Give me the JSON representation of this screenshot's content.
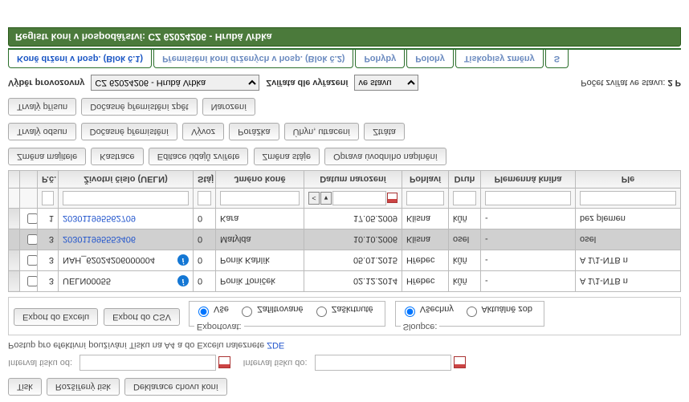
{
  "toolbar_top": {
    "print": "Tisk",
    "ext_print": "Rozšířený tisk",
    "decl": "Deklarace chovu koní"
  },
  "interval": {
    "from_label": "Interval tisku od:",
    "to_label": "Interval tisku do:",
    "from_value": "",
    "to_value": ""
  },
  "help_line": {
    "prefix": "Postup pro efektivní používání Tisku na A4 a do Excelu naleznete ",
    "link": "ZDE"
  },
  "export_row": {
    "excel": "Export do Excelu",
    "csv": "Export do CSV",
    "export_group_label": "Exportovat:",
    "opt_all": "Vše",
    "opt_filtered": "Zafiltrované",
    "opt_checked": "Zaškrtnuté",
    "cols_group_label": "Sloupce:",
    "opt_cols_all": "Všechny",
    "opt_cols_cur": "Aktuálně zob"
  },
  "grid": {
    "headers": {
      "pc": "P.č.",
      "ueln": "Životní číslo (UELN)",
      "staj": "Stáj",
      "jmeno": "Jméno koně",
      "datum": "Datum narození",
      "pohlavi": "Pohlaví",
      "druh": "Druh",
      "kniha": "Plemenná kniha",
      "ple": "Ple"
    },
    "rows": [
      {
        "pc": "3",
        "ueln": "UELN00055",
        "info": true,
        "staj": "0",
        "jmeno": "Poník Toníček",
        "datum": "02.12.2014",
        "pohlavi": "Hřebec",
        "druh": "kůň",
        "kniha": "-",
        "ple": "A 1/1-NTB n",
        "link": false,
        "sel": false
      },
      {
        "pc": "3",
        "ueln": "NAH_62024206000004",
        "info": true,
        "staj": "0",
        "jmeno": "Poník Kahlík",
        "datum": "05.01.2015",
        "pohlavi": "Hřebec",
        "druh": "kůň",
        "kniha": "-",
        "ple": "A 1/1-NTB n",
        "link": false,
        "sel": false
      },
      {
        "pc": "3",
        "ueln": "203011995553406",
        "info": false,
        "staj": "0",
        "jmeno": "Matylda",
        "datum": "10.10.2006",
        "pohlavi": "Klisna",
        "druh": "osel",
        "kniha": "-",
        "ple": "osel",
        "link": true,
        "sel": true
      },
      {
        "pc": "1",
        "ueln": "203011995562709",
        "info": false,
        "staj": "0",
        "jmeno": "Kara",
        "datum": "17.05.2009",
        "pohlavi": "Klisna",
        "druh": "kůň",
        "kniha": "-",
        "ple": "bez plemen",
        "link": true,
        "sel": false
      }
    ]
  },
  "actions1": {
    "zmena_maj": "Změna majitele",
    "kastrace": "Kastrace",
    "editace": "Editace údajů zvířete",
    "zmena_staje": "Změna stáje",
    "oprava": "Oprava úvodního naplnění"
  },
  "actions2": {
    "trvaly_odsun": "Trvalý odsun",
    "docasne": "Dočasné přemístění",
    "vyvoz": "Vývoz",
    "porazka": "Porážka",
    "uhyn": "Úhyn, utracení",
    "ztrata": "Ztráta"
  },
  "actions3": {
    "trvaly_prisun": "Trvalý přísun",
    "docasne_zpet": "Dočasné přemístění zpět",
    "narozeni": "Narození"
  },
  "selectors": {
    "provoz_label": "Výběr provozovny",
    "provoz_value": "CZ 62024206 - Hrubá Vrbka",
    "vyraz_label": "Zvířata dle vyřazení",
    "vyraz_value": "ve stavu",
    "count_label": "Počet zvířat ve stavu: ",
    "count_value": "2 P"
  },
  "tabs": {
    "t1": "Koně držení v hosp. (Blok č.1)",
    "t2": "Přemístění koní držených v hosp. (Blok č.2)",
    "t3": "Pohyby",
    "t4": "Polohy",
    "t5": "Tiskopisy změny",
    "t6": "S"
  },
  "header_bar": "Registr koní v hospodářství: CZ 62024206 - Hrubá Vrbka"
}
